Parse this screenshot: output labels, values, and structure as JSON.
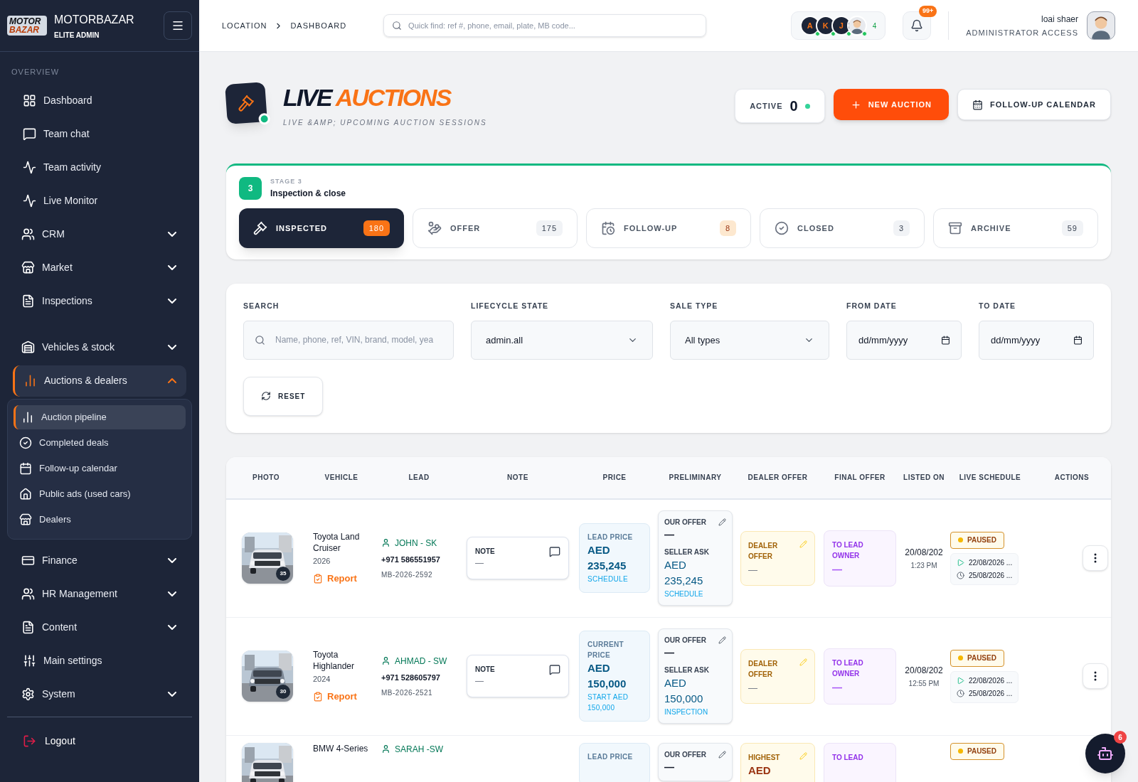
{
  "brand": {
    "logo_lines": [
      "MOTOR",
      "BAZAR"
    ],
    "name": "MOTORBAZAR",
    "subtitle": "ELITE ADMIN"
  },
  "sidebar": {
    "section": "OVERVIEW",
    "items": [
      {
        "kind": "link",
        "label": "Dashboard",
        "selected": false
      },
      {
        "kind": "link",
        "label": "Team chat",
        "selected": false
      },
      {
        "kind": "link",
        "label": "Team activity",
        "selected": false
      },
      {
        "kind": "link",
        "label": "Live Monitor",
        "selected": false
      },
      {
        "kind": "group",
        "label": "CRM",
        "selected": false,
        "expanded": false
      },
      {
        "kind": "group",
        "label": "Market",
        "selected": false,
        "expanded": false
      },
      {
        "kind": "group",
        "label": "Inspections",
        "selected": false,
        "expanded": false
      },
      {
        "kind": "group",
        "label": "Vehicles & stock",
        "selected": false,
        "expanded": false
      },
      {
        "kind": "group",
        "label": "Auctions & dealers",
        "selected": true,
        "expanded": true,
        "children": [
          {
            "label": "Auction pipeline",
            "selected": true
          },
          {
            "label": "Completed deals",
            "selected": false
          },
          {
            "label": "Follow-up calendar",
            "selected": false
          },
          {
            "label": "Public ads (used cars)",
            "selected": false
          },
          {
            "label": "Dealers",
            "selected": false
          }
        ]
      },
      {
        "kind": "group",
        "label": "Finance",
        "selected": false,
        "expanded": false
      },
      {
        "kind": "group",
        "label": "HR Management",
        "selected": false,
        "expanded": false
      },
      {
        "kind": "group",
        "label": "Content",
        "selected": false,
        "expanded": false
      },
      {
        "kind": "link",
        "label": "Main settings",
        "selected": false
      },
      {
        "kind": "group",
        "label": "System",
        "selected": false,
        "expanded": false
      }
    ],
    "logout": "Logout"
  },
  "topbar": {
    "breadcrumb": [
      "LOCATION",
      "DASHBOARD"
    ],
    "search": {
      "placeholder": "Quick find: ref #, phone, email, plate, MB code..."
    },
    "online_users": [
      {
        "initial": "A",
        "online": true
      },
      {
        "initial": "K",
        "online": true
      },
      {
        "initial": "J",
        "online": true
      },
      {
        "kind": "avatar",
        "online": true
      }
    ],
    "online_count": "4",
    "notifications": "99+",
    "user": {
      "name": "loai shaer",
      "role": "ADMINISTRATOR ACCESS"
    }
  },
  "page": {
    "title": [
      "LIVE",
      "AUCTIONS"
    ],
    "subtitle": "LIVE &AMP; UPCOMING AUCTION SESSIONS",
    "active": {
      "label": "ACTIVE",
      "count": "0"
    },
    "buttons": [
      "NEW AUCTION",
      "FOLLOW-UP CALENDAR"
    ]
  },
  "stage": {
    "number": "3",
    "label": "STAGE 3",
    "title": "Inspection & close"
  },
  "stage_tabs": [
    {
      "label": "INSPECTED",
      "count": "180",
      "selected": true,
      "alert": false
    },
    {
      "label": "OFFER",
      "count": "175",
      "selected": false,
      "alert": false
    },
    {
      "label": "FOLLOW-UP",
      "count": "8",
      "selected": false,
      "alert": true
    },
    {
      "label": "CLOSED",
      "count": "3",
      "selected": false,
      "alert": false
    },
    {
      "label": "ARCHIVE",
      "count": "59",
      "selected": false,
      "alert": false
    }
  ],
  "filters": {
    "search": {
      "label": "SEARCH",
      "placeholder": "Name, phone, ref, VIN, brand, model, yea"
    },
    "lifecycle": {
      "label": "LIFECYCLE STATE",
      "value": "admin.all"
    },
    "sale_type": {
      "label": "SALE TYPE",
      "value": "All types"
    },
    "from_date": {
      "label": "FROM DATE",
      "placeholder": "dd/mm/yyyy"
    },
    "to_date": {
      "label": "TO DATE",
      "placeholder": "dd/mm/yyyy"
    },
    "reset": "RESET"
  },
  "table": {
    "columns": [
      "PHOTO",
      "VEHICLE",
      "LEAD",
      "NOTE",
      "PRICE",
      "PRELIMINARY",
      "DEALER OFFER",
      "FINAL OFFER",
      "LISTED ON",
      "LIVE SCHEDULE",
      "ACTIONS"
    ],
    "rows": [
      {
        "photo_count": "35",
        "vehicle": "Toyota Land Cruiser",
        "year": "2026",
        "report": "Report",
        "lead": "JOHN - SK",
        "phone": "+971 586551957",
        "ref": "MB-2026-2592",
        "note_label": "NOTE",
        "note": "—",
        "price_label": "LEAD PRICE",
        "price_currency": "AED",
        "price": "235,245",
        "price_sub": "SCHEDULE",
        "our_offer_label": "OUR OFFER",
        "our_offer": "—",
        "seller_label": "SELLER ASK",
        "seller_currency": "AED",
        "seller_ask": "235,245",
        "seller_sub": "SCHEDULE",
        "dealer_label": "DEALER OFFER",
        "dealer_value": "—",
        "final_label": "TO LEAD OWNER",
        "final_value": "—",
        "listed_date": "20/08/202",
        "listed_time": "1:23 PM",
        "status": {
          "label": "PAUSED",
          "color": "#f5b800"
        },
        "start": "22/08/2026 ...",
        "end": "25/08/2026 ..."
      },
      {
        "photo_count": "30",
        "vehicle": "Toyota Highlander",
        "year": "2024",
        "report": "Report",
        "lead": "AHMAD - SW",
        "phone": "+971 528605797",
        "ref": "MB-2026-2521",
        "note_label": "NOTE",
        "note": "—",
        "price_label": "CURRENT PRICE",
        "price_currency": "AED",
        "price": "150,000",
        "price_sub": "START AED 150,000",
        "our_offer_label": "OUR OFFER",
        "our_offer": "—",
        "seller_label": "SELLER ASK",
        "seller_currency": "AED",
        "seller_ask": "150,000",
        "seller_sub": "INSPECTION",
        "dealer_label": "DEALER OFFER",
        "dealer_value": "—",
        "final_label": "TO LEAD OWNER",
        "final_value": "—",
        "listed_date": "20/08/202",
        "listed_time": "12:55 PM",
        "status": {
          "label": "PAUSED",
          "color": "#f5b800"
        },
        "start": "22/08/2026 ...",
        "end": "25/08/2026 ..."
      },
      {
        "vehicle": "BMW 4-Series",
        "lead": "SARAH -SW",
        "price_label": "LEAD PRICE",
        "our_offer_label": "OUR OFFER",
        "our_offer": "—",
        "dealer_label": "HIGHEST",
        "dealer_currency": "AED",
        "final_label": "TO LEAD",
        "status": {
          "label": "PAUSED",
          "color": "#f5b800"
        }
      }
    ]
  },
  "assistant": {
    "badge": "6"
  }
}
